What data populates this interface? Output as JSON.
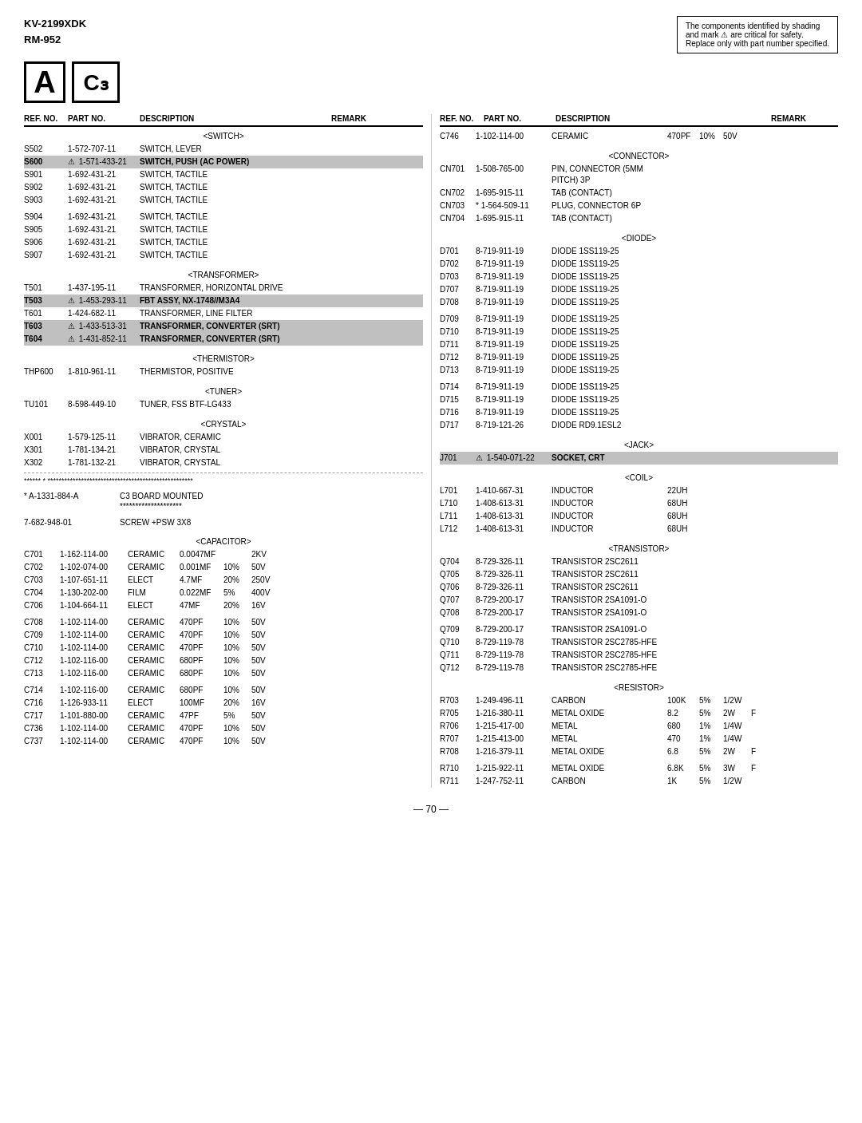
{
  "header": {
    "model": "KV-2199XDK",
    "submodel": "RM-952",
    "safety_notice_lines": [
      "The components identified by shading",
      "and mark ⚠ are critical for safety.",
      "Replace only with part number specified."
    ]
  },
  "logos": {
    "a_label": "A",
    "c3_label": "C₃"
  },
  "left_col_headers": [
    "REF. NO.",
    "PART NO.",
    "DESCRIPTION",
    "",
    "REMARK"
  ],
  "right_col_headers": [
    "REF. NO.",
    "PART NO.",
    "DESCRIPTION",
    "",
    "",
    "REMARK"
  ],
  "left_sections": [
    {
      "type": "section",
      "label": "<SWITCH>"
    },
    {
      "type": "row",
      "ref": "S502",
      "part": "1-572-707-11",
      "desc": "SWITCH, LEVER",
      "extra": "",
      "remark": "",
      "highlight": false,
      "warn": false
    },
    {
      "type": "row",
      "ref": "S600",
      "part": "1-571-433-21",
      "desc": "SWITCH, PUSH (AC POWER)",
      "extra": "",
      "remark": "",
      "highlight": true,
      "warn": true
    },
    {
      "type": "row",
      "ref": "S901",
      "part": "1-692-431-21",
      "desc": "SWITCH, TACTILE",
      "extra": "",
      "remark": "",
      "highlight": false,
      "warn": false
    },
    {
      "type": "row",
      "ref": "S902",
      "part": "1-692-431-21",
      "desc": "SWITCH, TACTILE",
      "extra": "",
      "remark": "",
      "highlight": false,
      "warn": false
    },
    {
      "type": "row",
      "ref": "S903",
      "part": "1-692-431-21",
      "desc": "SWITCH, TACTILE",
      "extra": "",
      "remark": "",
      "highlight": false,
      "warn": false
    },
    {
      "type": "spacer"
    },
    {
      "type": "row",
      "ref": "S904",
      "part": "1-692-431-21",
      "desc": "SWITCH, TACTILE",
      "extra": "",
      "remark": "",
      "highlight": false,
      "warn": false
    },
    {
      "type": "row",
      "ref": "S905",
      "part": "1-692-431-21",
      "desc": "SWITCH, TACTILE",
      "extra": "",
      "remark": "",
      "highlight": false,
      "warn": false
    },
    {
      "type": "row",
      "ref": "S906",
      "part": "1-692-431-21",
      "desc": "SWITCH, TACTILE",
      "extra": "",
      "remark": "",
      "highlight": false,
      "warn": false
    },
    {
      "type": "row",
      "ref": "S907",
      "part": "1-692-431-21",
      "desc": "SWITCH, TACTILE",
      "extra": "",
      "remark": "",
      "highlight": false,
      "warn": false
    },
    {
      "type": "spacer"
    },
    {
      "type": "section",
      "label": "<TRANSFORMER>"
    },
    {
      "type": "row",
      "ref": "T501",
      "part": "1-437-195-11",
      "desc": "TRANSFORMER, HORIZONTAL DRIVE",
      "extra": "",
      "remark": "",
      "highlight": false,
      "warn": false
    },
    {
      "type": "row",
      "ref": "T503",
      "part": "1-453-293-11",
      "desc": "FBT ASSY, NX-1748//M3A4",
      "extra": "",
      "remark": "",
      "highlight": true,
      "warn": true
    },
    {
      "type": "row",
      "ref": "T601",
      "part": "1-424-682-11",
      "desc": "TRANSFORMER, LINE FILTER",
      "extra": "",
      "remark": "",
      "highlight": false,
      "warn": false
    },
    {
      "type": "row",
      "ref": "T603",
      "part": "1-433-513-31",
      "desc": "TRANSFORMER, CONVERTER (SRT)",
      "extra": "",
      "remark": "",
      "highlight": true,
      "warn": true
    },
    {
      "type": "row",
      "ref": "T604",
      "part": "1-431-852-11",
      "desc": "TRANSFORMER, CONVERTER (SRT)",
      "extra": "",
      "remark": "",
      "highlight": true,
      "warn": true
    },
    {
      "type": "spacer"
    },
    {
      "type": "section",
      "label": "<THERMISTOR>"
    },
    {
      "type": "row",
      "ref": "THP600",
      "part": "1-810-961-11",
      "desc": "THERMISTOR, POSITIVE",
      "extra": "",
      "remark": "",
      "highlight": false,
      "warn": false
    },
    {
      "type": "spacer"
    },
    {
      "type": "section",
      "label": "<TUNER>"
    },
    {
      "type": "row",
      "ref": "TU101",
      "part": "8-598-449-10",
      "desc": "TUNER, FSS BTF-LG433",
      "extra": "",
      "remark": "",
      "highlight": false,
      "warn": false
    },
    {
      "type": "spacer"
    },
    {
      "type": "section",
      "label": "<CRYSTAL>"
    },
    {
      "type": "row",
      "ref": "X001",
      "part": "1-579-125-11",
      "desc": "VIBRATOR, CERAMIC",
      "extra": "",
      "remark": "",
      "highlight": false,
      "warn": false
    },
    {
      "type": "row",
      "ref": "X301",
      "part": "1-781-134-21",
      "desc": "VIBRATOR, CRYSTAL",
      "extra": "",
      "remark": "",
      "highlight": false,
      "warn": false
    },
    {
      "type": "row",
      "ref": "X302",
      "part": "1-781-132-21",
      "desc": "VIBRATOR, CRYSTAL",
      "extra": "",
      "remark": "",
      "highlight": false,
      "warn": false
    },
    {
      "type": "separator"
    },
    {
      "type": "note",
      "text": "****** * ****************************************************"
    },
    {
      "type": "spacer"
    },
    {
      "type": "note2",
      "col1": "* A-1331-884-A",
      "col2": "C3 BOARD MOUNTED"
    },
    {
      "type": "note3",
      "col2": "********************"
    },
    {
      "type": "spacer"
    },
    {
      "type": "note2",
      "col1": "7-682-948-01",
      "col2": "SCREW +PSW 3X8"
    },
    {
      "type": "spacer"
    },
    {
      "type": "section",
      "label": "<CAPACITOR>"
    },
    {
      "type": "row5",
      "ref": "C701",
      "part": "1-162-114-00",
      "desc": "CERAMIC",
      "val": "0.0047MF",
      "tol": "",
      "remark": "2KV"
    },
    {
      "type": "row5",
      "ref": "C702",
      "part": "1-102-074-00",
      "desc": "CERAMIC",
      "val": "0.001MF",
      "tol": "10%",
      "remark": "50V"
    },
    {
      "type": "row5",
      "ref": "C703",
      "part": "1-107-651-11",
      "desc": "ELECT",
      "val": "4.7MF",
      "tol": "20%",
      "remark": "250V"
    },
    {
      "type": "row5",
      "ref": "C704",
      "part": "1-130-202-00",
      "desc": "FILM",
      "val": "0.022MF",
      "tol": "5%",
      "remark": "400V"
    },
    {
      "type": "row5",
      "ref": "C706",
      "part": "1-104-664-11",
      "desc": "ELECT",
      "val": "47MF",
      "tol": "20%",
      "remark": "16V"
    },
    {
      "type": "spacer"
    },
    {
      "type": "row5",
      "ref": "C708",
      "part": "1-102-114-00",
      "desc": "CERAMIC",
      "val": "470PF",
      "tol": "10%",
      "remark": "50V"
    },
    {
      "type": "row5",
      "ref": "C709",
      "part": "1-102-114-00",
      "desc": "CERAMIC",
      "val": "470PF",
      "tol": "10%",
      "remark": "50V"
    },
    {
      "type": "row5",
      "ref": "C710",
      "part": "1-102-114-00",
      "desc": "CERAMIC",
      "val": "470PF",
      "tol": "10%",
      "remark": "50V"
    },
    {
      "type": "row5",
      "ref": "C712",
      "part": "1-102-116-00",
      "desc": "CERAMIC",
      "val": "680PF",
      "tol": "10%",
      "remark": "50V"
    },
    {
      "type": "row5",
      "ref": "C713",
      "part": "1-102-116-00",
      "desc": "CERAMIC",
      "val": "680PF",
      "tol": "10%",
      "remark": "50V"
    },
    {
      "type": "spacer"
    },
    {
      "type": "row5",
      "ref": "C714",
      "part": "1-102-116-00",
      "desc": "CERAMIC",
      "val": "680PF",
      "tol": "10%",
      "remark": "50V"
    },
    {
      "type": "row5",
      "ref": "C716",
      "part": "1-126-933-11",
      "desc": "ELECT",
      "val": "100MF",
      "tol": "20%",
      "remark": "16V"
    },
    {
      "type": "row5",
      "ref": "C717",
      "part": "1-101-880-00",
      "desc": "CERAMIC",
      "val": "47PF",
      "tol": "5%",
      "remark": "50V"
    },
    {
      "type": "row5",
      "ref": "C736",
      "part": "1-102-114-00",
      "desc": "CERAMIC",
      "val": "470PF",
      "tol": "10%",
      "remark": "50V"
    },
    {
      "type": "row5",
      "ref": "C737",
      "part": "1-102-114-00",
      "desc": "CERAMIC",
      "val": "470PF",
      "tol": "10%",
      "remark": "50V"
    }
  ],
  "right_sections": [
    {
      "type": "row6",
      "ref": "C746",
      "part": "1-102-114-00",
      "desc": "CERAMIC",
      "val": "470PF",
      "tol": "10%",
      "remark": "50V"
    },
    {
      "type": "spacer"
    },
    {
      "type": "section",
      "label": "<CONNECTOR>"
    },
    {
      "type": "row6",
      "ref": "CN701",
      "part": "1-508-765-00",
      "desc": "PIN, CONNECTOR (5MM PITCH) 3P",
      "val": "",
      "tol": "",
      "remark": ""
    },
    {
      "type": "row6",
      "ref": "CN702",
      "part": "1-695-915-11",
      "desc": "TAB (CONTACT)",
      "val": "",
      "tol": "",
      "remark": ""
    },
    {
      "type": "row6",
      "ref": "CN703",
      "part": "* 1-564-509-11",
      "desc": "PLUG, CONNECTOR 6P",
      "val": "",
      "tol": "",
      "remark": ""
    },
    {
      "type": "row6",
      "ref": "CN704",
      "part": "1-695-915-11",
      "desc": "TAB (CONTACT)",
      "val": "",
      "tol": "",
      "remark": ""
    },
    {
      "type": "spacer"
    },
    {
      "type": "section",
      "label": "<DIODE>"
    },
    {
      "type": "row6",
      "ref": "D701",
      "part": "8-719-911-19",
      "desc": "DIODE 1SS119-25",
      "val": "",
      "tol": "",
      "remark": ""
    },
    {
      "type": "row6",
      "ref": "D702",
      "part": "8-719-911-19",
      "desc": "DIODE 1SS119-25",
      "val": "",
      "tol": "",
      "remark": ""
    },
    {
      "type": "row6",
      "ref": "D703",
      "part": "8-719-911-19",
      "desc": "DIODE 1SS119-25",
      "val": "",
      "tol": "",
      "remark": ""
    },
    {
      "type": "row6",
      "ref": "D707",
      "part": "8-719-911-19",
      "desc": "DIODE 1SS119-25",
      "val": "",
      "tol": "",
      "remark": ""
    },
    {
      "type": "row6",
      "ref": "D708",
      "part": "8-719-911-19",
      "desc": "DIODE 1SS119-25",
      "val": "",
      "tol": "",
      "remark": ""
    },
    {
      "type": "spacer"
    },
    {
      "type": "row6",
      "ref": "D709",
      "part": "8-719-911-19",
      "desc": "DIODE 1SS119-25",
      "val": "",
      "tol": "",
      "remark": ""
    },
    {
      "type": "row6",
      "ref": "D710",
      "part": "8-719-911-19",
      "desc": "DIODE 1SS119-25",
      "val": "",
      "tol": "",
      "remark": ""
    },
    {
      "type": "row6",
      "ref": "D711",
      "part": "8-719-911-19",
      "desc": "DIODE 1SS119-25",
      "val": "",
      "tol": "",
      "remark": ""
    },
    {
      "type": "row6",
      "ref": "D712",
      "part": "8-719-911-19",
      "desc": "DIODE 1SS119-25",
      "val": "",
      "tol": "",
      "remark": ""
    },
    {
      "type": "row6",
      "ref": "D713",
      "part": "8-719-911-19",
      "desc": "DIODE 1SS119-25",
      "val": "",
      "tol": "",
      "remark": ""
    },
    {
      "type": "spacer"
    },
    {
      "type": "row6",
      "ref": "D714",
      "part": "8-719-911-19",
      "desc": "DIODE 1SS119-25",
      "val": "",
      "tol": "",
      "remark": ""
    },
    {
      "type": "row6",
      "ref": "D715",
      "part": "8-719-911-19",
      "desc": "DIODE 1SS119-25",
      "val": "",
      "tol": "",
      "remark": ""
    },
    {
      "type": "row6",
      "ref": "D716",
      "part": "8-719-911-19",
      "desc": "DIODE 1SS119-25",
      "val": "",
      "tol": "",
      "remark": ""
    },
    {
      "type": "row6",
      "ref": "D717",
      "part": "8-719-121-26",
      "desc": "DIODE RD9.1ESL2",
      "val": "",
      "tol": "",
      "remark": ""
    },
    {
      "type": "spacer"
    },
    {
      "type": "section",
      "label": "<JACK>"
    },
    {
      "type": "row6",
      "ref": "J701",
      "part": "⚠ 1-540-071-22",
      "desc": "SOCKET, CRT",
      "val": "",
      "tol": "",
      "remark": "",
      "highlight": true,
      "warn": true
    },
    {
      "type": "spacer"
    },
    {
      "type": "section",
      "label": "<COIL>"
    },
    {
      "type": "row6",
      "ref": "L701",
      "part": "1-410-667-31",
      "desc": "INDUCTOR",
      "val": "22UH",
      "tol": "",
      "remark": ""
    },
    {
      "type": "row6",
      "ref": "L710",
      "part": "1-408-613-31",
      "desc": "INDUCTOR",
      "val": "68UH",
      "tol": "",
      "remark": ""
    },
    {
      "type": "row6",
      "ref": "L711",
      "part": "1-408-613-31",
      "desc": "INDUCTOR",
      "val": "68UH",
      "tol": "",
      "remark": ""
    },
    {
      "type": "row6",
      "ref": "L712",
      "part": "1-408-613-31",
      "desc": "INDUCTOR",
      "val": "68UH",
      "tol": "",
      "remark": ""
    },
    {
      "type": "spacer"
    },
    {
      "type": "section",
      "label": "<TRANSISTOR>"
    },
    {
      "type": "row6",
      "ref": "Q704",
      "part": "8-729-326-11",
      "desc": "TRANSISTOR 2SC2611",
      "val": "",
      "tol": "",
      "remark": ""
    },
    {
      "type": "row6",
      "ref": "Q705",
      "part": "8-729-326-11",
      "desc": "TRANSISTOR 2SC2611",
      "val": "",
      "tol": "",
      "remark": ""
    },
    {
      "type": "row6",
      "ref": "Q706",
      "part": "8-729-326-11",
      "desc": "TRANSISTOR 2SC2611",
      "val": "",
      "tol": "",
      "remark": ""
    },
    {
      "type": "row6",
      "ref": "Q707",
      "part": "8-729-200-17",
      "desc": "TRANSISTOR 2SA1091-O",
      "val": "",
      "tol": "",
      "remark": ""
    },
    {
      "type": "row6",
      "ref": "Q708",
      "part": "8-729-200-17",
      "desc": "TRANSISTOR 2SA1091-O",
      "val": "",
      "tol": "",
      "remark": ""
    },
    {
      "type": "spacer"
    },
    {
      "type": "row6",
      "ref": "Q709",
      "part": "8-729-200-17",
      "desc": "TRANSISTOR 2SA1091-O",
      "val": "",
      "tol": "",
      "remark": ""
    },
    {
      "type": "row6",
      "ref": "Q710",
      "part": "8-729-119-78",
      "desc": "TRANSISTOR 2SC2785-HFE",
      "val": "",
      "tol": "",
      "remark": ""
    },
    {
      "type": "row6",
      "ref": "Q711",
      "part": "8-729-119-78",
      "desc": "TRANSISTOR 2SC2785-HFE",
      "val": "",
      "tol": "",
      "remark": ""
    },
    {
      "type": "row6",
      "ref": "Q712",
      "part": "8-729-119-78",
      "desc": "TRANSISTOR 2SC2785-HFE",
      "val": "",
      "tol": "",
      "remark": ""
    },
    {
      "type": "spacer"
    },
    {
      "type": "section",
      "label": "<RESISTOR>"
    },
    {
      "type": "row7",
      "ref": "R703",
      "part": "1-249-496-11",
      "desc": "CARBON",
      "val": "100K",
      "tol": "5%",
      "remark": "1/2W"
    },
    {
      "type": "row7",
      "ref": "R705",
      "part": "1-216-380-11",
      "desc": "METAL OXIDE",
      "val": "8.2",
      "tol": "5%",
      "remark": "2W",
      "flag": "F"
    },
    {
      "type": "row7",
      "ref": "R706",
      "part": "1-215-417-00",
      "desc": "METAL",
      "val": "680",
      "tol": "1%",
      "remark": "1/4W"
    },
    {
      "type": "row7",
      "ref": "R707",
      "part": "1-215-413-00",
      "desc": "METAL",
      "val": "470",
      "tol": "1%",
      "remark": "1/4W"
    },
    {
      "type": "row7",
      "ref": "R708",
      "part": "1-216-379-11",
      "desc": "METAL OXIDE",
      "val": "6.8",
      "tol": "5%",
      "remark": "2W",
      "flag": "F"
    },
    {
      "type": "spacer"
    },
    {
      "type": "row7",
      "ref": "R710",
      "part": "1-215-922-11",
      "desc": "METAL OXIDE",
      "val": "6.8K",
      "tol": "5%",
      "remark": "3W",
      "flag": "F"
    },
    {
      "type": "row7",
      "ref": "R711",
      "part": "1-247-752-11",
      "desc": "CARBON",
      "val": "1K",
      "tol": "5%",
      "remark": "1/2W"
    }
  ],
  "page_number": "— 70 —"
}
